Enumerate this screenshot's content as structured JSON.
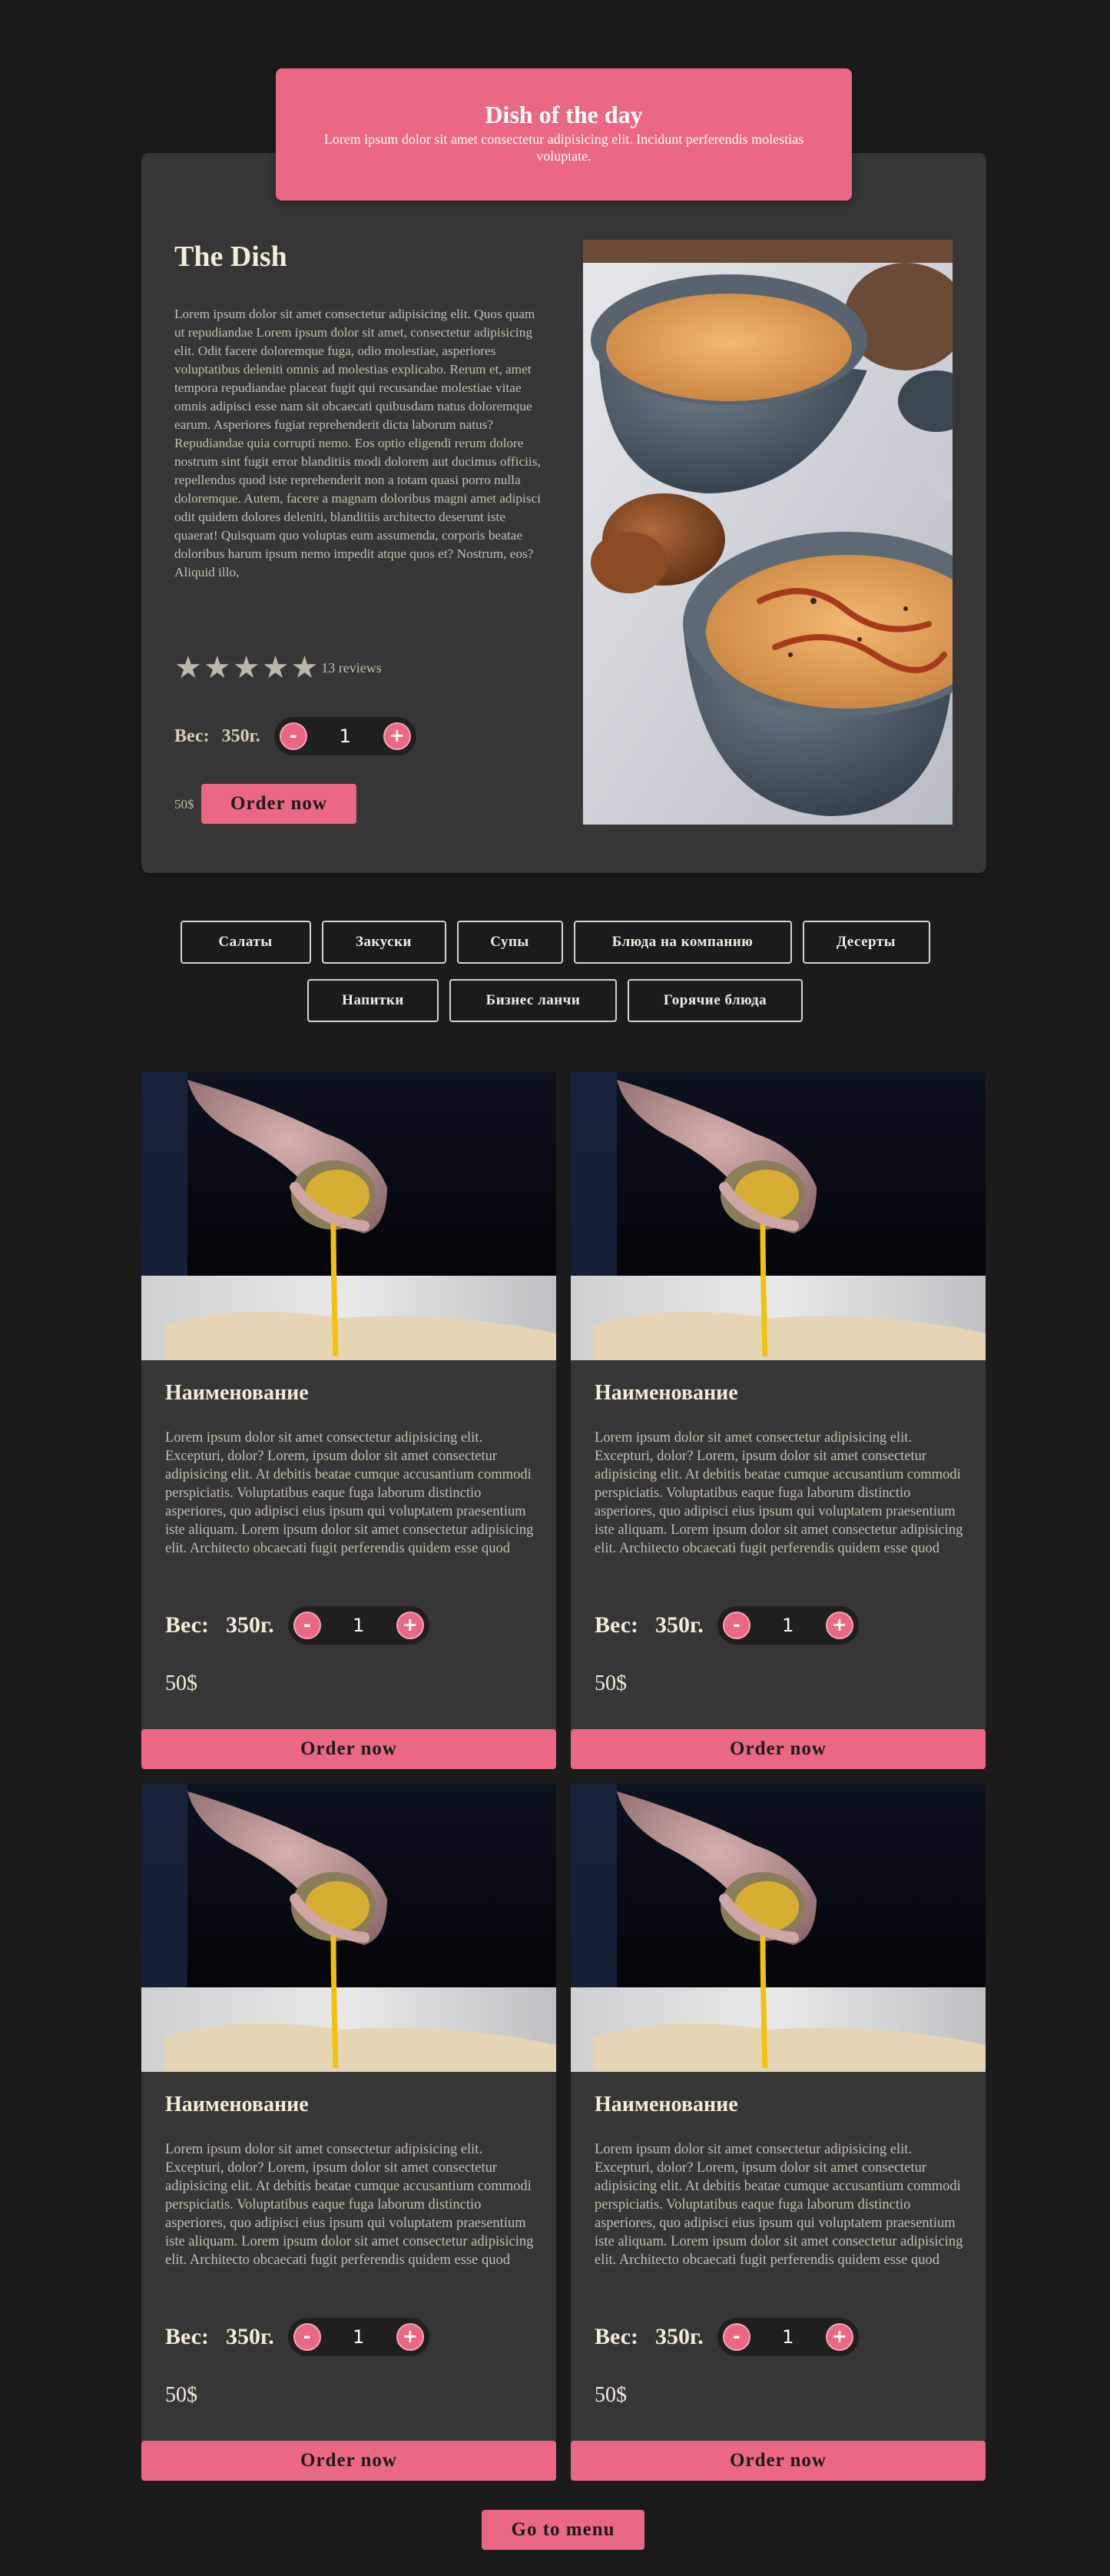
{
  "hero": {
    "title": "Dish of the day",
    "subtitle": "Lorem ipsum dolor sit amet consectetur adipisicing elit. Incidunt perferendis molestias voluptate."
  },
  "featured": {
    "title": "The Dish",
    "description": "Lorem ipsum dolor sit amet consectetur adipisicing elit. Quos quam ut repudiandae Lorem ipsum dolor sit amet, consectetur adipisicing elit. Odit facere doloremque fuga, odio molestiae, asperiores voluptatibus deleniti omnis ad molestias explicabo. Rerum et, amet tempora repudiandae placeat fugit qui recusandae molestiae vitae omnis adipisci esse nam sit obcaecati quibusdam natus doloremque earum. Asperiores fugiat reprehenderit dicta laborum natus? Repudiandae quia corrupti nemo. Eos optio eligendi rerum dolore nostrum sint fugit error blanditiis modi dolorem aut ducimus officiis, repellendus quod iste reprehenderit non a totam quasi porro nulla doloremque. Autem, facere a magnam doloribus magni amet adipisci odit quidem dolores deleniti, blanditiis architecto deserunt iste quaerat! Quisquam quo voluptas eum assumenda, corporis beatae doloribus harum ipsum nemo impedit atque quos et? Nostrum, eos? Aliquid illo,",
    "rating_stars": 5,
    "reviews": "13 reviews",
    "weight_label": "Вес:",
    "weight_value": "350г.",
    "quantity": "1",
    "minus": "-",
    "plus": "+",
    "price": "50$",
    "order_label": "Order now",
    "photo_icon": "soup-bowls-photo"
  },
  "categories": {
    "row1": [
      "Салаты",
      "Закуски",
      "Супы",
      "Блюда на компанию",
      "Десерты"
    ],
    "row2": [
      "Напитки",
      "Бизнес ланчи",
      "Горячие блюда"
    ]
  },
  "products": [
    {
      "title": "Наименование",
      "description": "Lorem ipsum dolor sit amet consectetur adipisicing elit. Excepturi, dolor? Lorem, ipsum dolor sit amet consectetur adipisicing elit. At debitis beatae cumque accusantium commodi perspiciatis. Voluptatibus eaque fuga laborum distinctio asperiores, quo adipisci eius ipsum qui voluptatem praesentium iste aliquam. Lorem ipsum dolor sit amet consectetur adipisicing elit. Architecto obcaecati fugit perferendis quidem esse quod",
      "weight_label": "Вес:",
      "weight_value": "350г.",
      "quantity": "1",
      "minus": "-",
      "plus": "+",
      "price": "50$",
      "order_label": "Order now"
    },
    {
      "title": "Наименование",
      "description": "Lorem ipsum dolor sit amet consectetur adipisicing elit. Excepturi, dolor? Lorem, ipsum dolor sit amet consectetur adipisicing elit. At debitis beatae cumque accusantium commodi perspiciatis. Voluptatibus eaque fuga laborum distinctio asperiores, quo adipisci eius ipsum qui voluptatem praesentium iste aliquam. Lorem ipsum dolor sit amet consectetur adipisicing elit. Architecto obcaecati fugit perferendis quidem esse quod",
      "weight_label": "Вес:",
      "weight_value": "350г.",
      "quantity": "1",
      "minus": "-",
      "plus": "+",
      "price": "50$",
      "order_label": "Order now"
    },
    {
      "title": "Наименование",
      "description": "Lorem ipsum dolor sit amet consectetur adipisicing elit. Excepturi, dolor? Lorem, ipsum dolor sit amet consectetur adipisicing elit. At debitis beatae cumque accusantium commodi perspiciatis. Voluptatibus eaque fuga laborum distinctio asperiores, quo adipisci eius ipsum qui voluptatem praesentium iste aliquam. Lorem ipsum dolor sit amet consectetur adipisicing elit. Architecto obcaecati fugit perferendis quidem esse quod",
      "weight_label": "Вес:",
      "weight_value": "350г.",
      "quantity": "1",
      "minus": "-",
      "plus": "+",
      "price": "50$",
      "order_label": "Order now"
    },
    {
      "title": "Наименование",
      "description": "Lorem ipsum dolor sit amet consectetur adipisicing elit. Excepturi, dolor? Lorem, ipsum dolor sit amet consectetur adipisicing elit. At debitis beatae cumque accusantium commodi perspiciatis. Voluptatibus eaque fuga laborum distinctio asperiores, quo adipisci eius ipsum qui voluptatem praesentium iste aliquam. Lorem ipsum dolor sit amet consectetur adipisicing elit. Architecto obcaecati fugit perferendis quidem esse quod",
      "weight_label": "Вес:",
      "weight_value": "350г.",
      "quantity": "1",
      "minus": "-",
      "plus": "+",
      "price": "50$",
      "order_label": "Order now"
    }
  ],
  "product_photo_icon": "honey-pour-photo",
  "go_menu_label": "Go to menu",
  "colors": {
    "background": "#1b1b1b",
    "card": "#363636",
    "accent": "#ea6883",
    "text": "#c8bfae",
    "heading": "#f4ecd8"
  }
}
